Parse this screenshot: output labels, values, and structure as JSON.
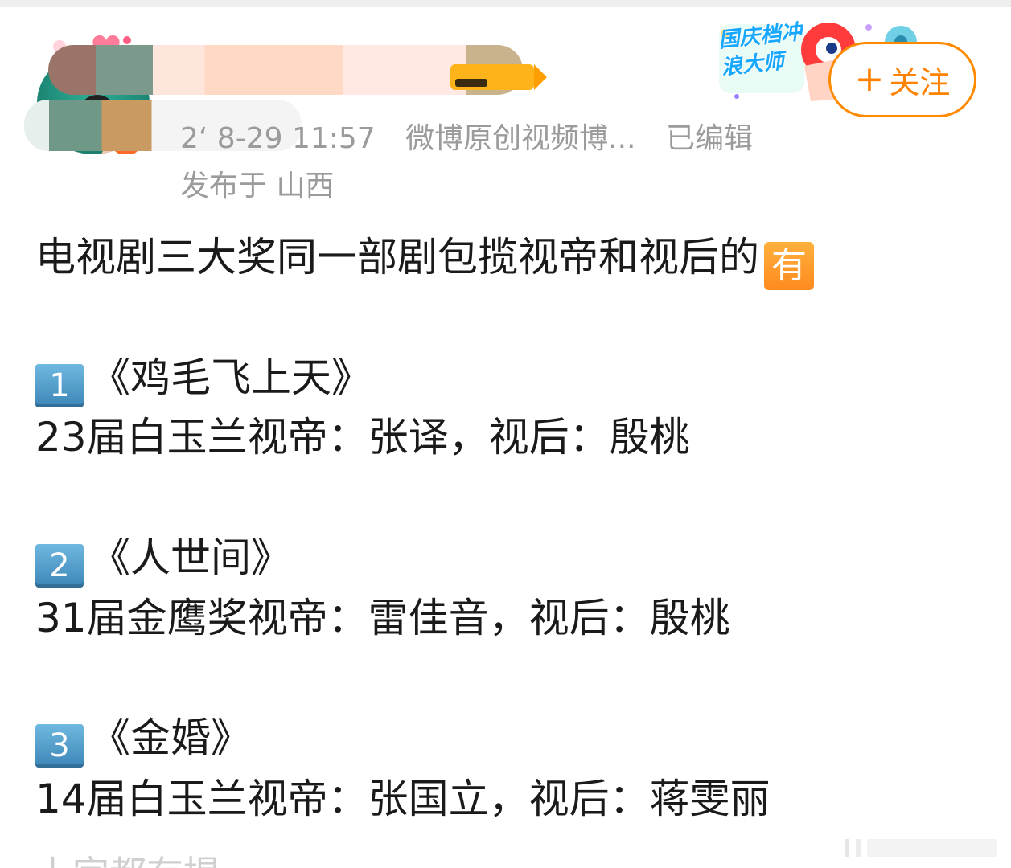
{
  "post": {
    "meta": {
      "timestamp": "2ʻ  8-29 11:57",
      "source": "微博原创视频博...",
      "edited": "已编辑"
    },
    "location": "发布于 山西",
    "follow_button": {
      "plus": "+",
      "label": "关注"
    },
    "event_badge": {
      "text": "国庆档冲浪大师"
    },
    "headline": "电视剧三大奖同一部剧包揽视帝和视后的",
    "headline_badge": "有",
    "items": [
      {
        "key": "1",
        "title": "《鸡毛飞上天》",
        "detail": "23届白玉兰视帝：张译，视后：殷桃"
      },
      {
        "key": "2",
        "title": "《人世间》",
        "detail": "31届金鹰奖视帝：雷佳音，视后：殷桃"
      },
      {
        "key": "3",
        "title": "《金婚》",
        "detail": "14届白玉兰视帝：张国立，视后：蒋雯丽"
      }
    ],
    "cut_text": "上字都有提"
  },
  "colors": {
    "accent": "#ff8200",
    "meta_gray": "#9b9b9b",
    "text": "#1a1a1a",
    "key_blue": "#3c86b8"
  }
}
